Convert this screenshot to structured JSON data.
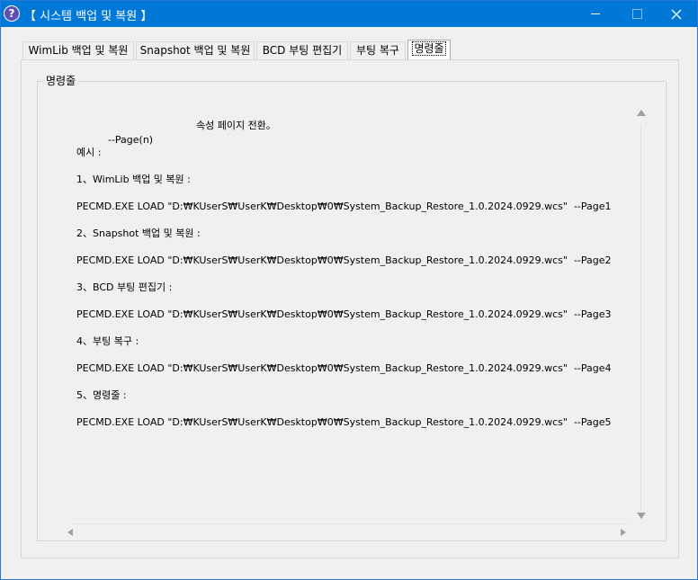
{
  "window": {
    "title": "【 시스템 백업 및 복원 】",
    "icon": "help-question-icon",
    "accent_color": "#0078d7"
  },
  "tabs": [
    {
      "label": "WimLib 백업 및 복원",
      "active": false
    },
    {
      "label": "Snapshot 백업 및 복원",
      "active": false
    },
    {
      "label": "BCD 부팅 편집기",
      "active": false
    },
    {
      "label": "부팅 복구",
      "active": false
    },
    {
      "label": "명령줄",
      "active": true
    }
  ],
  "group": {
    "label": "명령줄"
  },
  "content": {
    "lines": [
      "--Page(n)",
      "예시 :",
      "1、WimLib 백업 및 복원 :",
      "PECMD.EXE LOAD \"D:₩KUserS₩UserK₩Desktop₩0₩System_Backup_Restore_1.0.2024.0929.wcs\"  --Page1",
      "2、Snapshot 백업 및 복원 :",
      "PECMD.EXE LOAD \"D:₩KUserS₩UserK₩Desktop₩0₩System_Backup_Restore_1.0.2024.0929.wcs\"  --Page2",
      "3、BCD 부팅 편집기 :",
      "PECMD.EXE LOAD \"D:₩KUserS₩UserK₩Desktop₩0₩System_Backup_Restore_1.0.2024.0929.wcs\"  --Page3",
      "4、부팅 복구 :",
      "PECMD.EXE LOAD \"D:₩KUserS₩UserK₩Desktop₩0₩System_Backup_Restore_1.0.2024.0929.wcs\"  --Page4",
      "5、명령줄 :",
      "PECMD.EXE LOAD \"D:₩KUserS₩UserK₩Desktop₩0₩System_Backup_Restore_1.0.2024.0929.wcs\"  --Page5"
    ],
    "first_line_description": "속성 페이지 전환。"
  }
}
